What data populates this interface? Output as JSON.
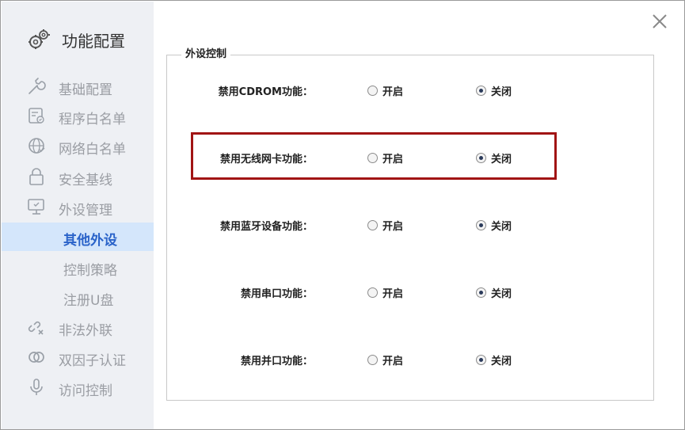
{
  "sidebar": {
    "header": {
      "title": "功能配置",
      "icon": "gears-icon"
    },
    "items": [
      {
        "label": "基础配置",
        "icon": "wrench-icon"
      },
      {
        "label": "程序白名单",
        "icon": "program-list-icon"
      },
      {
        "label": "网络白名单",
        "icon": "globe-icon"
      },
      {
        "label": "安全基线",
        "icon": "lock-icon"
      },
      {
        "label": "外设管理",
        "icon": "monitor-icon"
      },
      {
        "label": "其他外设",
        "sub": true,
        "active": true
      },
      {
        "label": "控制策略",
        "sub": true
      },
      {
        "label": "注册U盘",
        "sub": true
      },
      {
        "label": "非法外联",
        "icon": "link-broken-icon"
      },
      {
        "label": "双因子认证",
        "icon": "two-factor-icon"
      },
      {
        "label": "访问控制",
        "icon": "microphone-icon"
      }
    ]
  },
  "group": {
    "title": "外设控制",
    "rows": [
      {
        "label": "禁用CDROM功能：",
        "on_label": "开启",
        "off_label": "关闭",
        "selected": "off"
      },
      {
        "label": "禁用无线网卡功能：",
        "on_label": "开启",
        "off_label": "关闭",
        "selected": "off"
      },
      {
        "label": "禁用蓝牙设备功能：",
        "on_label": "开启",
        "off_label": "关闭",
        "selected": "off"
      },
      {
        "label": "禁用串口功能：",
        "on_label": "开启",
        "off_label": "关闭",
        "selected": "off"
      },
      {
        "label": "禁用并口功能：",
        "on_label": "开启",
        "off_label": "关闭",
        "selected": "off"
      }
    ]
  },
  "colors": {
    "accent": "#2a63c9",
    "active_bg": "#d4e6fb",
    "highlight": "#a11414"
  }
}
